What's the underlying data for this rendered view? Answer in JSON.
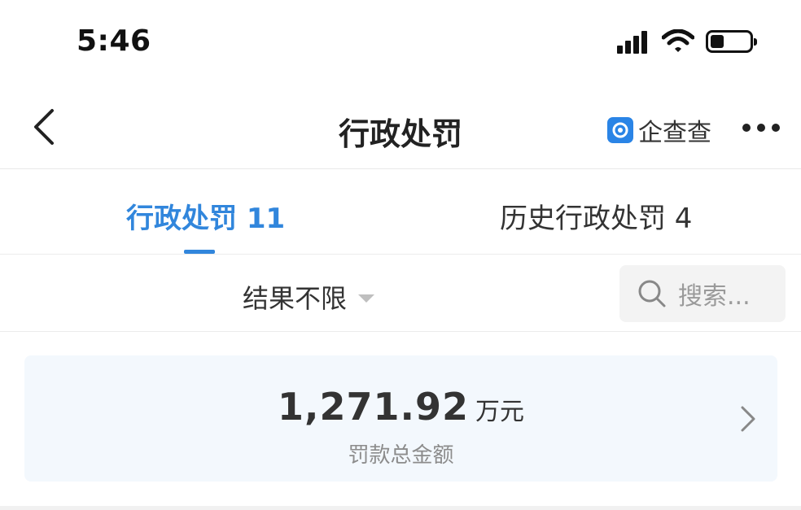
{
  "status_bar": {
    "time": "5:46",
    "battery_level": 0.35
  },
  "nav": {
    "title": "行政处罚",
    "brand_text": "企查查",
    "back_icon": "chevron-left-icon",
    "more_icon": "more-horizontal-icon"
  },
  "tabs": [
    {
      "label": "行政处罚 11",
      "active": true
    },
    {
      "label": "历史行政处罚 4",
      "active": false
    }
  ],
  "filter": {
    "result_label": "结果不限",
    "search_placeholder": "搜索..."
  },
  "summary": {
    "amount": "1,271.92",
    "unit": "万元",
    "label": "罚款总金额"
  },
  "colors": {
    "accent": "#3186dc",
    "card_bg": "#f3f8fd",
    "brand_logo": "#2a84e6"
  }
}
